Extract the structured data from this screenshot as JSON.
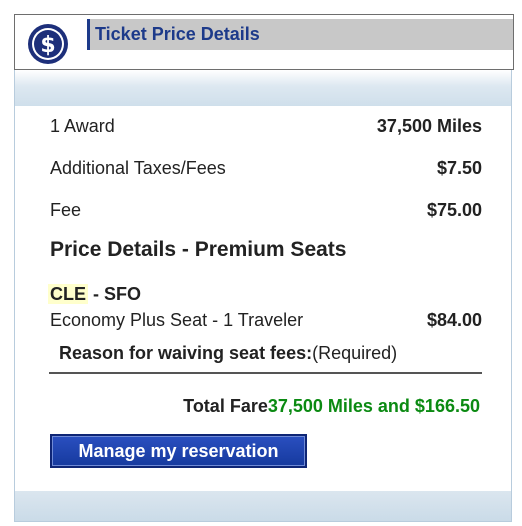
{
  "header": {
    "icon": "dollar-sign-icon",
    "title": "Ticket Price Details"
  },
  "price_rows": [
    {
      "label": "1 Award",
      "amount": "37,500 Miles"
    },
    {
      "label": "Additional Taxes/Fees",
      "amount": "$7.50"
    },
    {
      "label": "Fee",
      "amount": "$75.00"
    }
  ],
  "premium_seats": {
    "title": "Price Details - Premium Seats",
    "origin": "CLE",
    "destination": " - SFO",
    "seat_label": "Economy Plus Seat - 1 Traveler",
    "seat_amount": "$84.00",
    "reason_label": "Reason for waiving seat fees:",
    "reason_required": "(Required)"
  },
  "total": {
    "label": "Total Fare",
    "value": "37,500 Miles and $166.50"
  },
  "actions": {
    "manage_label": "Manage my reservation"
  },
  "colors": {
    "brand_blue": "#1d3a8a",
    "total_green": "#0b8a12",
    "origin_highlight": "#ffffcc"
  }
}
